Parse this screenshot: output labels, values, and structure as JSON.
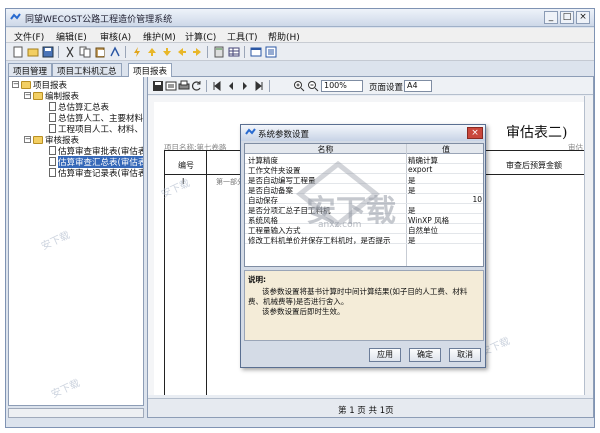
{
  "window": {
    "title": "同望WECOST公路工程造价管理系统",
    "minimize": "_",
    "maximize": "□",
    "close": "×"
  },
  "menu": [
    "文件(F)",
    "编辑(E)",
    "审核(A)",
    "维护(M)",
    "计算(C)",
    "工具(T)",
    "帮助(H)"
  ],
  "tabs": [
    "项目管理",
    "项目工料机汇总",
    "项目报表"
  ],
  "tree": {
    "root": "项目报表",
    "groups": [
      {
        "label": "编制报表",
        "items": [
          "总估算汇总表",
          "总估算人工、主要材料",
          "工程项目人工、材料、"
        ]
      },
      {
        "label": "审核报表",
        "items": [
          "估算审查审批表(审估表",
          "估算审查汇总表(审估表",
          "估算审查记录表(审估表"
        ]
      }
    ],
    "selected_index": 1
  },
  "report_toolbar": {
    "zoom": "100%",
    "page_setup_label": "页面设置",
    "paper_size": "A4"
  },
  "report": {
    "title": "审估表二)",
    "project_name": "项目名称:第七卷路",
    "page_label": "审估",
    "col_no": "编号",
    "col_amount": "审查后预算金额",
    "row1_no": "I",
    "row1_text": "第一部分"
  },
  "status": {
    "page_info": "第 1 页 共 1页"
  },
  "dialog": {
    "title": "系统参数设置",
    "col_name": "名称",
    "col_value": "值",
    "rows": [
      {
        "name": "计算精度",
        "value": "精确计算"
      },
      {
        "name": "工作文件夹设置",
        "value": "export"
      },
      {
        "name": "是否自动编写工程量",
        "value": "是"
      },
      {
        "name": "是否自动备案",
        "value": "是"
      },
      {
        "name": "自动保存",
        "value": "10"
      },
      {
        "name": "是否分项汇总子目工料机",
        "value": "是"
      },
      {
        "name": "系统风格",
        "value": "WinXP 风格"
      },
      {
        "name": "工程量输入方式",
        "value": "自然单位"
      },
      {
        "name": "修改工料机单价并保存工料机时，是否提示",
        "value": "是"
      }
    ],
    "desc_title": "说明:",
    "desc_body": "该参数设置将基书计算时中间计算结果(如子目的人工费、材料费、机械费等)是否进行舍入。",
    "desc_note": "该参数设置后即时生效。",
    "buttons": {
      "apply": "应用",
      "ok": "确定",
      "cancel": "取消"
    }
  },
  "watermark": {
    "logo_text": "安下载",
    "logo_url": "anxz.com"
  }
}
